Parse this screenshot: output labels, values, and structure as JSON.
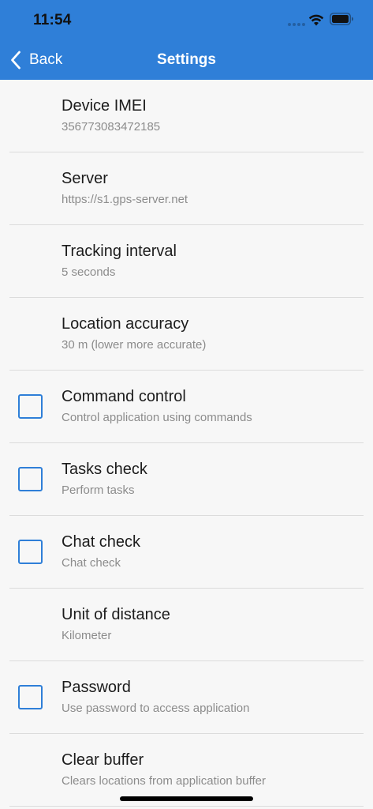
{
  "status_bar": {
    "time": "11:54"
  },
  "nav": {
    "back_label": "Back",
    "title": "Settings"
  },
  "colors": {
    "accent": "#2f7fd8",
    "background": "#f7f7f7"
  },
  "settings": [
    {
      "title": "Device IMEI",
      "subtitle": "356773083472185",
      "checkbox": false
    },
    {
      "title": "Server",
      "subtitle": "https://s1.gps-server.net",
      "checkbox": false
    },
    {
      "title": "Tracking interval",
      "subtitle": "5 seconds",
      "checkbox": false
    },
    {
      "title": "Location accuracy",
      "subtitle": "30 m (lower more accurate)",
      "checkbox": false
    },
    {
      "title": "Command control",
      "subtitle": "Control application using commands",
      "checkbox": true,
      "checked": false
    },
    {
      "title": "Tasks check",
      "subtitle": "Perform tasks",
      "checkbox": true,
      "checked": false
    },
    {
      "title": "Chat check",
      "subtitle": "Chat check",
      "checkbox": true,
      "checked": false
    },
    {
      "title": "Unit of distance",
      "subtitle": "Kilometer",
      "checkbox": false
    },
    {
      "title": "Password",
      "subtitle": "Use password to access application",
      "checkbox": true,
      "checked": false
    },
    {
      "title": "Clear buffer",
      "subtitle": "Clears locations from application buffer",
      "checkbox": false
    }
  ]
}
